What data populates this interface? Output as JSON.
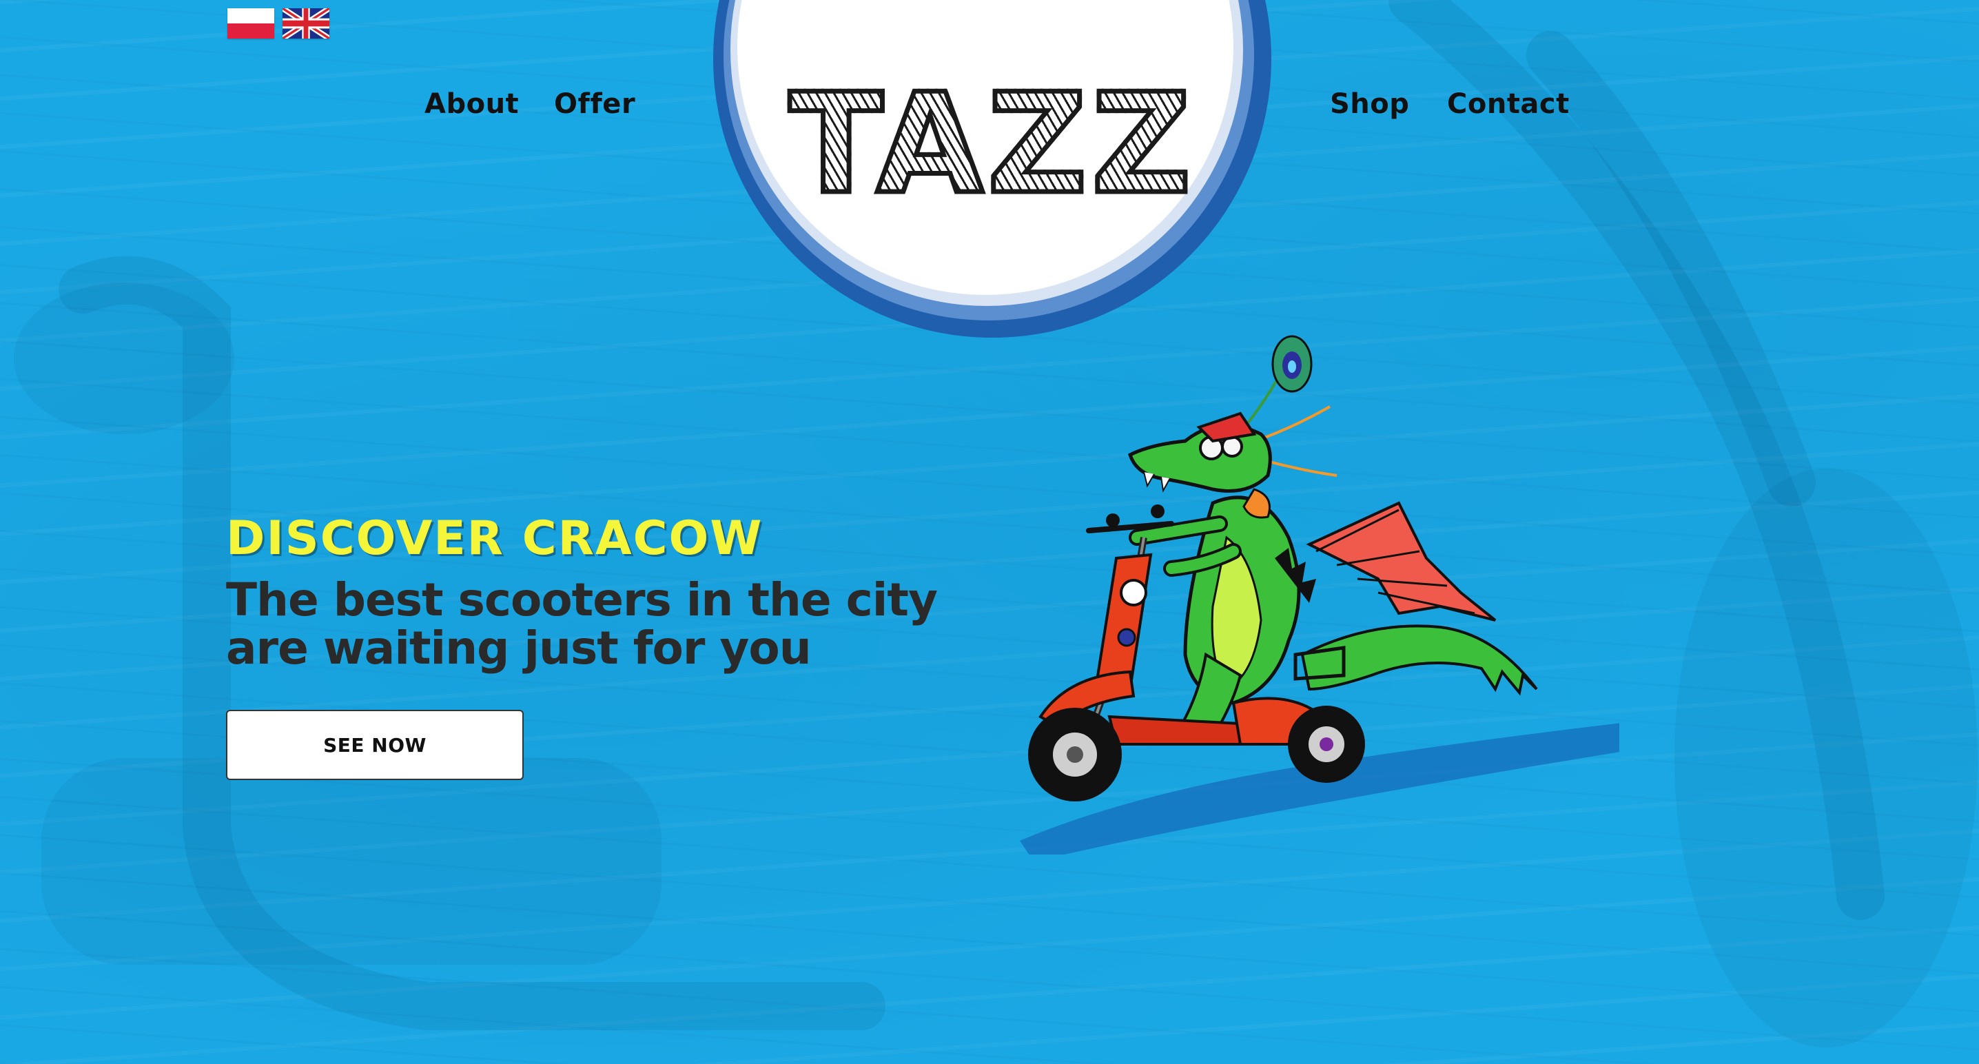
{
  "languages": {
    "polish_flag_icon": "polish-flag-icon",
    "uk_flag_icon": "uk-flag-icon"
  },
  "nav": {
    "about": "About",
    "offer": "Offer",
    "shop": "Shop",
    "contact": "Contact"
  },
  "logo": {
    "text": "TAZZ"
  },
  "hero": {
    "kicker": "DISCOVER CRACOW",
    "line1": "The best scooters in the city",
    "line2": "are waiting just for you",
    "cta_label": "SEE NOW"
  },
  "mascot": {
    "icon": "dragon-on-scooter-illustration"
  },
  "colors": {
    "background": "#1aa8e4",
    "kicker": "#f5f53a",
    "headline": "#2a2a2a",
    "nav_text": "#111111",
    "logo_ring": "#1f5fae",
    "dragon_green": "#3cbf3a",
    "scooter_red": "#e8401c"
  }
}
